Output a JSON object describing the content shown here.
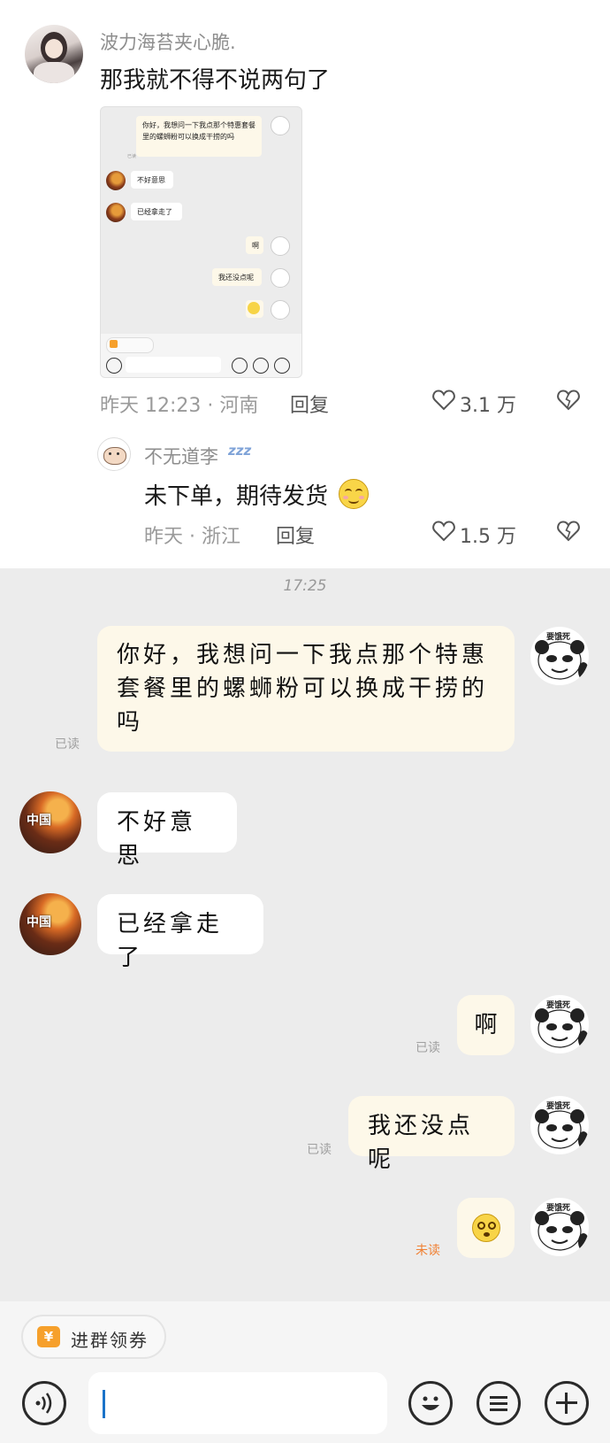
{
  "comment": {
    "username": "波力海苔夹心脆.",
    "text": "那我就不得不说两句了",
    "time_location": "昨天 12:23 · 河南",
    "reply_label": "回复",
    "like_count": "3.1 万"
  },
  "sub_comment": {
    "username": "不无道李",
    "text": "未下单，期待发货",
    "time_location": "昨天 · 浙江",
    "reply_label": "回复",
    "like_count": "1.5 万"
  },
  "chat": {
    "timestamp": "17:25",
    "avatar_tag": "要饿死",
    "food_avatar_text": "中国",
    "messages": [
      {
        "side": "me",
        "text": "你好，我想问一下我点那个特惠套餐里的螺蛳粉可以换成干捞的吗",
        "status": "已读"
      },
      {
        "side": "other",
        "text": "不好意思"
      },
      {
        "side": "other",
        "text": "已经拿走了"
      },
      {
        "side": "me",
        "text": "啊",
        "status": "已读"
      },
      {
        "side": "me",
        "text": "我还没点呢",
        "status": "已读"
      },
      {
        "side": "me",
        "text": "",
        "icon": "dizzy-face-emoji",
        "status": "未读"
      }
    ],
    "coupon_label": "进群领券",
    "input_value": ""
  },
  "colors": {
    "chat_background": "#ececec",
    "my_bubble": "#fdf8e9",
    "other_bubble": "#ffffff",
    "unread": "#f08033",
    "coupon_icon": "#f6a02b"
  }
}
